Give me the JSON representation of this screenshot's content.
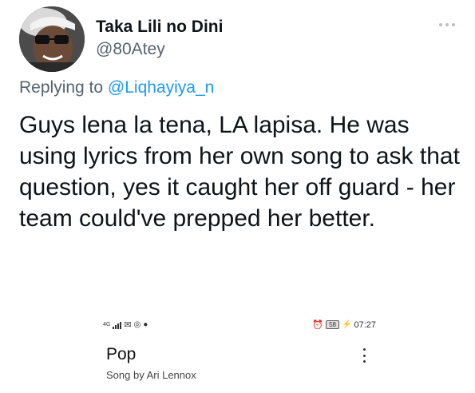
{
  "tweet": {
    "author_name": "Taka Lili no Dini",
    "author_handle": "@80Atey",
    "replying_prefix": "Replying to",
    "replying_to": "@Liqhayiya_n",
    "body": "Guys lena la tena, LA lapisa. He was using lyrics from her own song to ask that question, yes it caught her off guard - her team could've prepped her better."
  },
  "embedded_screenshot": {
    "status_bar": {
      "network": "4G",
      "battery": "58",
      "time": "07:27"
    },
    "song_title": "Pop",
    "song_subtitle": "Song by Ari Lennox"
  },
  "colors": {
    "text": "#0f1419",
    "muted": "#536471",
    "link": "#1d9bf0"
  }
}
